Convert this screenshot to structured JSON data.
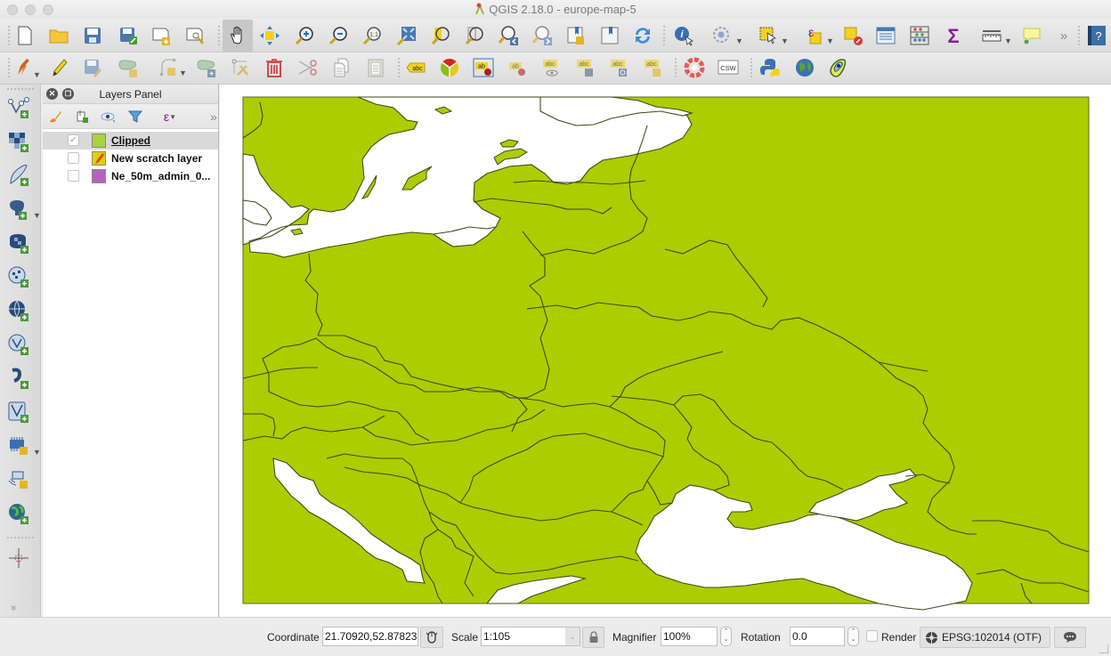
{
  "window": {
    "title": "QGIS 2.18.0 - europe-map-5",
    "traffic_lights": [
      "close",
      "minimize",
      "zoom"
    ]
  },
  "toolbar_row1": {
    "buttons": [
      {
        "name": "new-project",
        "icon": "new-project-icon"
      },
      {
        "name": "open-project",
        "icon": "folder-icon"
      },
      {
        "name": "save-project",
        "icon": "save-icon"
      },
      {
        "name": "save-project-as",
        "icon": "save-as-icon"
      },
      {
        "name": "new-print-composer",
        "icon": "new-composer-icon"
      },
      {
        "name": "composer-manager",
        "icon": "composer-manager-icon"
      },
      {
        "name": "pan-map",
        "icon": "pan-hand-icon",
        "active": true
      },
      {
        "name": "pan-to-selection",
        "icon": "pan-to-selection-icon"
      },
      {
        "name": "zoom-in",
        "icon": "zoom-in-icon"
      },
      {
        "name": "zoom-out",
        "icon": "zoom-out-icon"
      },
      {
        "name": "zoom-native",
        "icon": "zoom-native-icon",
        "label": "1:1"
      },
      {
        "name": "zoom-full",
        "icon": "zoom-full-icon"
      },
      {
        "name": "zoom-to-selection",
        "icon": "zoom-selection-icon"
      },
      {
        "name": "zoom-to-layer",
        "icon": "zoom-layer-icon"
      },
      {
        "name": "zoom-last",
        "icon": "zoom-last-icon"
      },
      {
        "name": "zoom-next",
        "icon": "zoom-next-icon"
      },
      {
        "name": "new-bookmark",
        "icon": "new-bookmark-icon"
      },
      {
        "name": "show-bookmarks",
        "icon": "bookmarks-icon"
      },
      {
        "name": "refresh",
        "icon": "refresh-icon"
      },
      {
        "name": "identify-features",
        "icon": "identify-icon"
      },
      {
        "name": "run-feature-action",
        "icon": "action-gear-icon"
      },
      {
        "name": "select-features",
        "icon": "select-icon"
      },
      {
        "name": "select-by-expression",
        "icon": "expression-select-icon",
        "label": "ε"
      },
      {
        "name": "deselect-all",
        "icon": "deselect-icon"
      },
      {
        "name": "open-attribute-table",
        "icon": "attribute-table-icon"
      },
      {
        "name": "field-calculator",
        "icon": "abacus-icon"
      },
      {
        "name": "statistical-summary",
        "icon": "sigma-icon",
        "label": "Σ"
      },
      {
        "name": "measure-line",
        "icon": "ruler-icon"
      },
      {
        "name": "map-tips",
        "icon": "speech-bubble-icon"
      },
      {
        "name": "more-tools",
        "icon": "chevron-double-right-icon",
        "label": "»"
      },
      {
        "name": "help",
        "icon": "help-icon",
        "label": "?"
      }
    ]
  },
  "toolbar_row2": {
    "buttons": [
      {
        "name": "current-edits",
        "icon": "pencils-icon"
      },
      {
        "name": "toggle-editing",
        "icon": "pencil-icon"
      },
      {
        "name": "save-layer-edits",
        "icon": "save-edits-icon"
      },
      {
        "name": "add-feature",
        "icon": "add-polygon-icon"
      },
      {
        "name": "add-circular-string",
        "icon": "circular-string-icon"
      },
      {
        "name": "move-feature",
        "icon": "move-feature-icon"
      },
      {
        "name": "node-tool",
        "icon": "node-tool-icon"
      },
      {
        "name": "delete-selected",
        "icon": "trash-icon"
      },
      {
        "name": "cut-features",
        "icon": "scissors-icon"
      },
      {
        "name": "copy-features",
        "icon": "copy-icon"
      },
      {
        "name": "paste-features",
        "icon": "paste-icon"
      },
      {
        "name": "layer-labeling",
        "icon": "label-abc-icon",
        "label": "abc"
      },
      {
        "name": "layer-diagram",
        "icon": "diagram-pie-icon"
      },
      {
        "name": "pin-labels",
        "icon": "pin-label-icon",
        "label": "ab"
      },
      {
        "name": "highlight-pinned-labels",
        "icon": "highlight-label-icon",
        "label": "ab"
      },
      {
        "name": "show-hide-labels",
        "icon": "show-label-icon",
        "label": "abc"
      },
      {
        "name": "move-label",
        "icon": "move-label-icon",
        "label": "abc"
      },
      {
        "name": "rotate-label",
        "icon": "rotate-label-icon",
        "label": "abc"
      },
      {
        "name": "change-label",
        "icon": "change-label-icon",
        "label": "abc"
      },
      {
        "name": "gps-tool",
        "icon": "lifebuoy-icon"
      },
      {
        "name": "csw-metasearch",
        "icon": "csw-icon",
        "label": "CSW"
      },
      {
        "name": "python-console",
        "icon": "python-icon"
      },
      {
        "name": "globe",
        "icon": "globe-icon"
      },
      {
        "name": "heatmap",
        "icon": "contour-icon"
      }
    ]
  },
  "left_toolbar": {
    "buttons": [
      {
        "name": "add-vector-layer",
        "icon": "add-vector-icon"
      },
      {
        "name": "add-raster-layer",
        "icon": "add-raster-icon"
      },
      {
        "name": "add-delimited-text-layer",
        "icon": "add-delimited-icon"
      },
      {
        "name": "add-postgis-layer",
        "icon": "add-postgis-icon"
      },
      {
        "name": "add-spatialite-layer",
        "icon": "add-spatialite-icon"
      },
      {
        "name": "add-wms-layer",
        "icon": "add-wms-icon"
      },
      {
        "name": "add-wcs-layer",
        "icon": "add-wcs-icon"
      },
      {
        "name": "add-wfs-layer",
        "icon": "add-wfs-icon"
      },
      {
        "name": "add-virtual-layer",
        "icon": "add-virtual-icon"
      },
      {
        "name": "add-oracle-layer",
        "icon": "add-oracle-icon"
      },
      {
        "name": "new-memory-layer",
        "icon": "memory-layer-icon"
      },
      {
        "name": "add-gps-layer",
        "icon": "gps-layer-icon"
      },
      {
        "name": "add-arcgis-layer",
        "icon": "globe-add-icon"
      },
      {
        "name": "coordinate-capture",
        "icon": "crosshair-icon"
      },
      {
        "name": "more-tools",
        "icon": "chevron-double-down-icon",
        "label": "»"
      }
    ]
  },
  "layers_panel": {
    "title": "Layers Panel",
    "tools": [
      {
        "name": "style-manager",
        "icon": "paintbrush-icon"
      },
      {
        "name": "add-group",
        "icon": "add-group-icon"
      },
      {
        "name": "manage-visibility",
        "icon": "eye-icon"
      },
      {
        "name": "filter-legend",
        "icon": "filter-icon"
      },
      {
        "name": "filter-by-expression",
        "icon": "expression-filter-icon",
        "label": "ε"
      },
      {
        "name": "more",
        "icon": "chevron-double-right-icon",
        "label": "»"
      }
    ],
    "layers": [
      {
        "name": "Clipped",
        "checked": true,
        "selected": true,
        "swatch": "#a9d23f",
        "underline": true
      },
      {
        "name": "New scratch layer",
        "checked": false,
        "selected": false,
        "swatch": "#e0d000",
        "icon": "pencil-icon"
      },
      {
        "name": "Ne_50m_admin_0...",
        "checked": false,
        "selected": false,
        "swatch": "#b860c0"
      }
    ]
  },
  "map": {
    "land_color": "#accd00",
    "border_color": "#3d4a1a",
    "water_color": "#ffffff"
  },
  "statusbar": {
    "coordinate_label": "Coordinate",
    "coordinate_value": "21.70920,52.87823",
    "scale_label": "Scale",
    "scale_value": "1:105",
    "magnifier_label": "Magnifier",
    "magnifier_value": "100%",
    "rotation_label": "Rotation",
    "rotation_value": "0.0",
    "render_label": "Render",
    "render_checked": false,
    "crs_label": "EPSG:102014 (OTF)"
  }
}
